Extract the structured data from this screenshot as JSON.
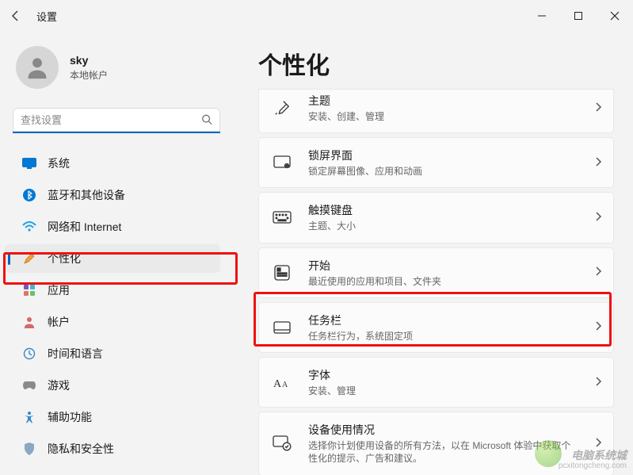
{
  "window": {
    "title": "设置"
  },
  "user": {
    "name": "sky",
    "type": "本地帐户"
  },
  "search": {
    "placeholder": "查找设置"
  },
  "nav": [
    {
      "key": "system",
      "label": "系统"
    },
    {
      "key": "bluetooth",
      "label": "蓝牙和其他设备"
    },
    {
      "key": "network",
      "label": "网络和 Internet"
    },
    {
      "key": "personalization",
      "label": "个性化",
      "active": true
    },
    {
      "key": "apps",
      "label": "应用"
    },
    {
      "key": "accounts",
      "label": "帐户"
    },
    {
      "key": "time",
      "label": "时间和语言"
    },
    {
      "key": "gaming",
      "label": "游戏"
    },
    {
      "key": "accessibility",
      "label": "辅助功能"
    },
    {
      "key": "privacy",
      "label": "隐私和安全性"
    }
  ],
  "page": {
    "title": "个性化"
  },
  "cards": [
    {
      "key": "themes",
      "title": "主题",
      "sub": "安装、创建、管理"
    },
    {
      "key": "lockscreen",
      "title": "锁屏界面",
      "sub": "锁定屏幕图像、应用和动画"
    },
    {
      "key": "touchkeyboard",
      "title": "触摸键盘",
      "sub": "主题、大小"
    },
    {
      "key": "start",
      "title": "开始",
      "sub": "最近使用的应用和项目、文件夹"
    },
    {
      "key": "taskbar",
      "title": "任务栏",
      "sub": "任务栏行为，系统固定项"
    },
    {
      "key": "fonts",
      "title": "字体",
      "sub": "安装、管理"
    },
    {
      "key": "deviceusage",
      "title": "设备使用情况",
      "sub": "选择你计划使用设备的所有方法，以在 Microsoft 体验中获取个性化的提示、广告和建议。"
    }
  ],
  "watermark": {
    "big": "电脑系统城",
    "small": "pcxitongcheng.com"
  }
}
